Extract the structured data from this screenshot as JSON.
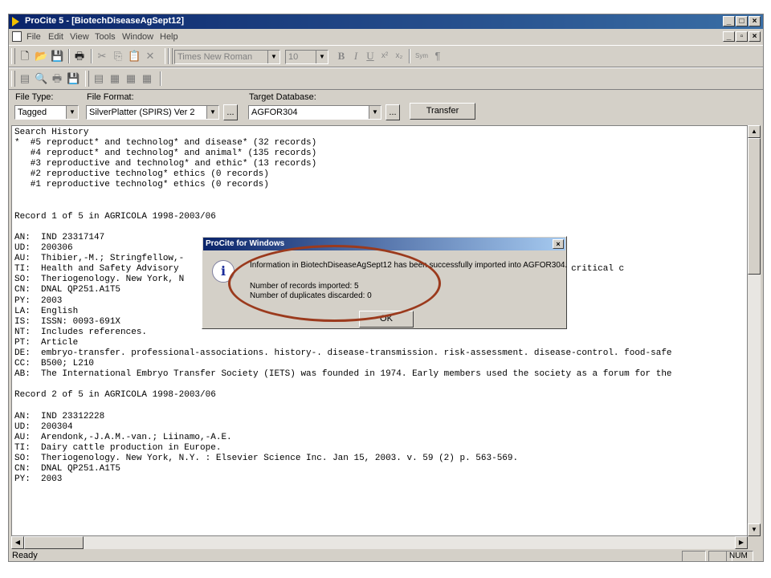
{
  "window": {
    "title": "ProCite 5 - [BiotechDiseaseAgSept12]"
  },
  "menu": [
    "File",
    "Edit",
    "View",
    "Tools",
    "Window",
    "Help"
  ],
  "format_toolbar": {
    "font": "Times New Roman",
    "size": "10",
    "bold": "B",
    "italic": "I",
    "underline": "U",
    "superscript": "x²",
    "subscript": "x₂",
    "sym": "Sym",
    "pilcrow": "¶"
  },
  "import_bar": {
    "file_type_label": "File Type:",
    "file_type_value": "Tagged",
    "file_format_label": "File Format:",
    "file_format_value": "SilverPlatter (SPIRS) Ver 2",
    "target_label": "Target Database:",
    "target_value": "AGFOR304",
    "browse_label": "...",
    "transfer_label": "Transfer"
  },
  "content_lines": [
    "Search History",
    "*  #5 reproduct* and technolog* and disease* (32 records)",
    "   #4 reproduct* and technolog* and animal* (135 records)",
    "   #3 reproductive and technolog* and ethic* (13 records)",
    "   #2 reproductive technolog* ethics (0 records)",
    "   #1 reproductive technolog* ethics (0 records)",
    "",
    "",
    "Record 1 of 5 in AGRICOLA 1998-2003/06",
    "",
    "AN:  IND 23317147",
    "UD:  200306",
    "AU:  Thibier,-M.; Stringfellow,-",
    "TI:  Health and Safety Advisory                                                       (IETS) has managed critical c",
    "SO:  Theriogenology. New York, N                                                    .",
    "CN:  DNAL QP251.A1T5",
    "PY:  2003",
    "LA:  English",
    "IS:  ISSN: 0093-691X",
    "NT:  Includes references.",
    "PT:  Article",
    "DE:  embryo-transfer. professional-associations. history-. disease-transmission. risk-assessment. disease-control. food-safe",
    "CC:  B500; L210",
    "AB:  The International Embryo Transfer Society (IETS) was founded in 1974. Early members used the society as a forum for the",
    "",
    "Record 2 of 5 in AGRICOLA 1998-2003/06",
    "",
    "AN:  IND 23312228",
    "UD:  200304",
    "AU:  Arendonk,-J.A.M.-van.; Liinamo,-A.E.",
    "TI:  Dairy cattle production in Europe.",
    "SO:  Theriogenology. New York, N.Y. : Elsevier Science Inc. Jan 15, 2003. v. 59 (2) p. 563-569.",
    "CN:  DNAL QP251.A1T5",
    "PY:  2003"
  ],
  "status": {
    "text": "Ready",
    "num": "NUM"
  },
  "dialog": {
    "title": "ProCite for Windows",
    "message": "Information in BiotechDiseaseAgSept12 has been successfully imported into AGFOR304.",
    "imported": "Number of records imported: 5",
    "duplicates": "Number of duplicates discarded: 0",
    "ok_label": "OK"
  }
}
